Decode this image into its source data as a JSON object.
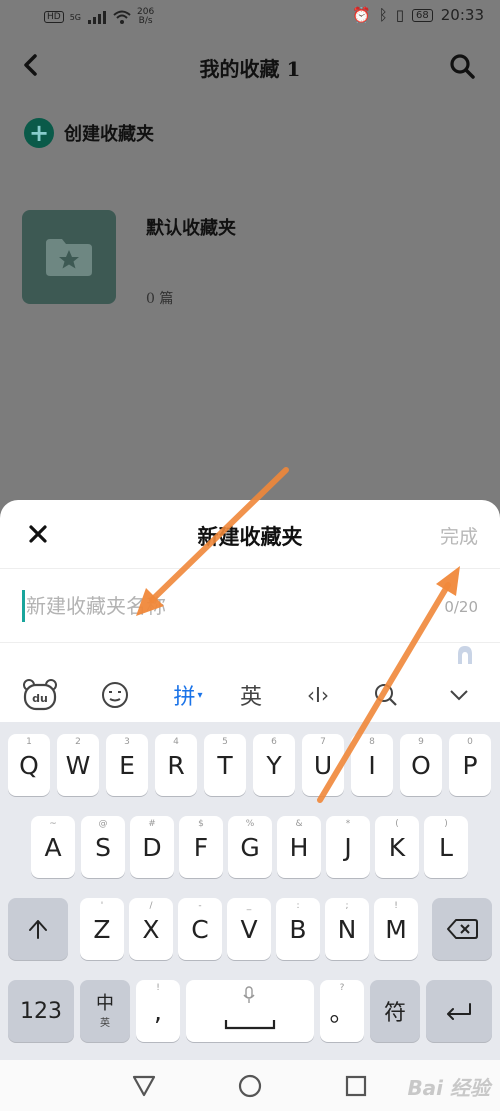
{
  "status_bar": {
    "network_tags": [
      "HD",
      "5G"
    ],
    "speed": "206\nB/s",
    "battery": "68",
    "time": "20:33"
  },
  "header": {
    "title": "我的收藏 1"
  },
  "create_folder": {
    "label": "创建收藏夹"
  },
  "folders": [
    {
      "name": "默认收藏夹",
      "count": "0 篇"
    }
  ],
  "dialog": {
    "title": "新建收藏夹",
    "done_label": "完成",
    "input_placeholder": "新建收藏夹名称",
    "input_value": "",
    "counter": "0/20"
  },
  "ime_toolbar": {
    "items": [
      {
        "name": "du-logo",
        "label": "du"
      },
      {
        "name": "emoji",
        "label": "☺"
      },
      {
        "name": "pinyin",
        "label": "拼"
      },
      {
        "name": "english",
        "label": "英"
      },
      {
        "name": "cursor",
        "label": "‹I›"
      },
      {
        "name": "search",
        "label": ""
      },
      {
        "name": "collapse",
        "label": "⌄"
      }
    ],
    "active": "拼"
  },
  "keyboard": {
    "row1": [
      {
        "sub": "1",
        "main": "Q"
      },
      {
        "sub": "2",
        "main": "W"
      },
      {
        "sub": "3",
        "main": "E"
      },
      {
        "sub": "4",
        "main": "R"
      },
      {
        "sub": "5",
        "main": "T"
      },
      {
        "sub": "6",
        "main": "Y"
      },
      {
        "sub": "7",
        "main": "U"
      },
      {
        "sub": "8",
        "main": "I"
      },
      {
        "sub": "9",
        "main": "O"
      },
      {
        "sub": "0",
        "main": "P"
      }
    ],
    "row2": [
      {
        "sub": "~",
        "main": "A"
      },
      {
        "sub": "@",
        "main": "S"
      },
      {
        "sub": "#",
        "main": "D"
      },
      {
        "sub": "$",
        "main": "F"
      },
      {
        "sub": "%",
        "main": "G"
      },
      {
        "sub": "&",
        "main": "H"
      },
      {
        "sub": "*",
        "main": "J"
      },
      {
        "sub": "(",
        "main": "K"
      },
      {
        "sub": ")",
        "main": "L"
      }
    ],
    "row3": [
      {
        "sub": "'",
        "main": "Z"
      },
      {
        "sub": "/",
        "main": "X"
      },
      {
        "sub": "-",
        "main": "C"
      },
      {
        "sub": "_",
        "main": "V"
      },
      {
        "sub": ":",
        "main": "B"
      },
      {
        "sub": ";",
        "main": "N"
      },
      {
        "sub": "!",
        "main": "M"
      }
    ],
    "row4": {
      "numbers": "123",
      "lang_main": "中",
      "lang_sub": "英",
      "comma_sub": "!",
      "comma": ",",
      "period_sub": "?",
      "period": "。",
      "symbols": "符"
    }
  },
  "watermark": "Bai 经验",
  "colors": {
    "accent": "#1a73e8",
    "caret": "#19a59c",
    "create_icon": "#0a5a49",
    "arrow": "#f0883a"
  }
}
